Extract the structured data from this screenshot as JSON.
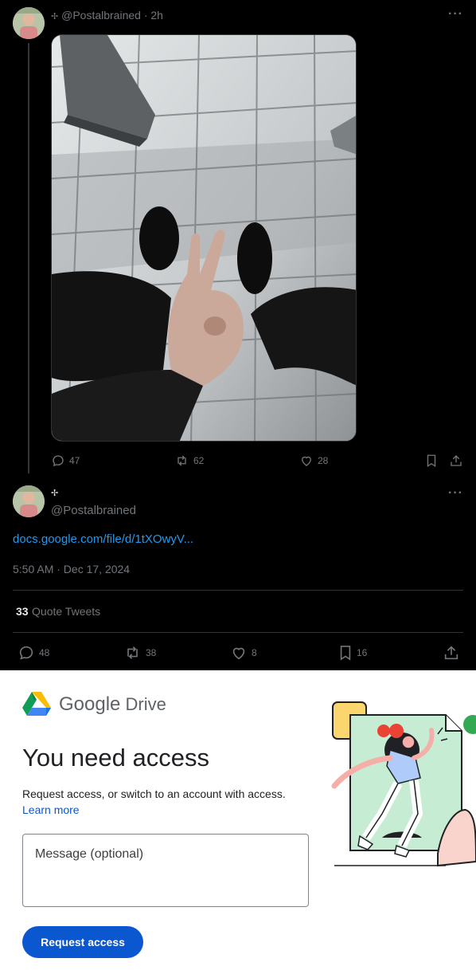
{
  "tweet": {
    "badge": "✢",
    "handle": "@Postalbrained",
    "time": "2h",
    "more": "···",
    "stats": {
      "replies": "47",
      "retweets": "62",
      "likes": "28"
    }
  },
  "reply": {
    "badge": "✢",
    "handle": "@Postalbrained",
    "more": "···",
    "link": "docs.google.com/file/d/1tXOwyV...",
    "timestamp": "5:50 AM · Dec 17, 2024",
    "quote_count": "33",
    "quote_label": "Quote Tweets",
    "stats": {
      "replies": "48",
      "retweets": "38",
      "likes": "8",
      "bookmarks": "16"
    }
  },
  "drive": {
    "brand_google": "Google",
    "brand_drive": "Drive",
    "title": "You need access",
    "description": "Request access, or switch to an account with access.",
    "learn_more": "Learn more",
    "message_placeholder": "Message (optional)",
    "request_button": "Request access"
  },
  "icons": {
    "reply": "speech-bubble-icon",
    "retweet": "retweet-icon",
    "like": "heart-icon",
    "bookmark": "bookmark-icon",
    "share": "share-icon",
    "drive_logo": "google-drive-logo"
  },
  "colors": {
    "link": "#1d9bf0",
    "muted": "#71767b",
    "drive_button": "#0b57d0"
  }
}
